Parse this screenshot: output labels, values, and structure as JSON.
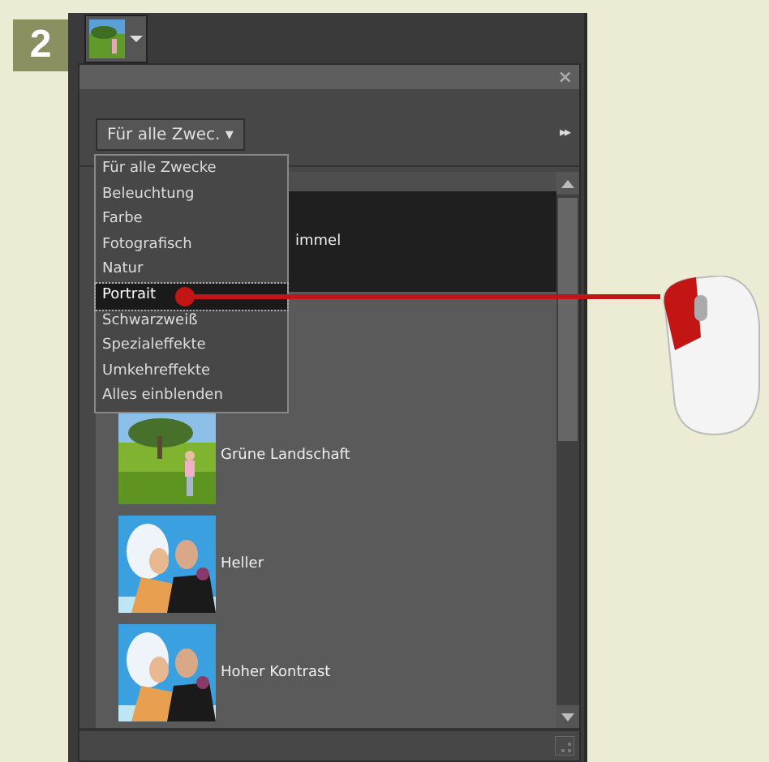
{
  "step": "2",
  "panel": {
    "close": "×",
    "filter": {
      "label": "Für alle Zwec.",
      "caret": "▾"
    },
    "more": "▸▸"
  },
  "effects": [
    {
      "label": "immel",
      "selected": true
    },
    {
      "label": "Grüne Landschaft",
      "selected": false,
      "kind": "picture"
    },
    {
      "label": "Heller",
      "selected": false,
      "kind": "picture"
    },
    {
      "label": "Hoher Kontrast",
      "selected": false,
      "kind": "picture"
    }
  ],
  "menu": [
    {
      "label": "Für alle Zwecke",
      "selected": false
    },
    {
      "label": "Beleuchtung",
      "selected": false
    },
    {
      "label": "Farbe",
      "selected": false
    },
    {
      "label": "Fotografisch",
      "selected": false
    },
    {
      "label": "Natur",
      "selected": false
    },
    {
      "label": "Portrait",
      "selected": true
    },
    {
      "label": "Schwarzweiß",
      "selected": false
    },
    {
      "label": "Spezialeffekte",
      "selected": false
    },
    {
      "label": "Umkehreffekte",
      "selected": false
    },
    {
      "label": "Alles einblenden",
      "selected": false
    }
  ]
}
